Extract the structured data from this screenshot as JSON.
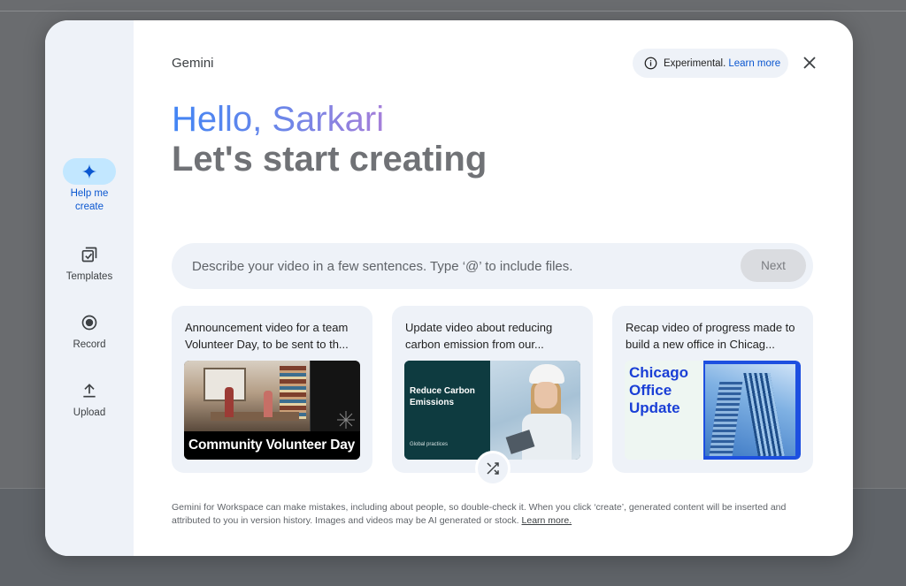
{
  "rail": {
    "items": [
      {
        "label": "Help me create",
        "icon": "sparkle-icon",
        "active": true
      },
      {
        "label": "Templates",
        "icon": "templates-icon",
        "active": false
      },
      {
        "label": "Record",
        "icon": "record-icon",
        "active": false
      },
      {
        "label": "Upload",
        "icon": "upload-icon",
        "active": false
      }
    ]
  },
  "header": {
    "brand": "Gemini",
    "experimental_label": "Experimental.",
    "learn_more": "Learn more",
    "close_icon": "close-icon",
    "info_icon": "info-icon"
  },
  "greeting": {
    "hello": "Hello, Sarkari",
    "subtitle": "Let's start creating"
  },
  "prompt": {
    "placeholder": "Describe your video in a few sentences. Type ‘@’ to include files.",
    "value": "",
    "next_label": "Next"
  },
  "cards": [
    {
      "text": "Announcement video for a team Volunteer Day, to be sent to th...",
      "thumb_caption": "Community Volunteer Day"
    },
    {
      "text": "Update video about reducing carbon emission from our...",
      "thumb_headline": "Reduce Carbon Emissions",
      "thumb_small": "Global practices"
    },
    {
      "text": "Recap video of progress made to build a new office in Chicag...",
      "thumb_title": "Chicago Office Update"
    }
  ],
  "shuffle_icon": "shuffle-icon",
  "disclaimer": {
    "text": "Gemini for Workspace can make mistakes, including about people, so double-check it. When you click ‘create’, generated content will be inserted and attributed to you in version history. Images and videos may be AI generated or stock.",
    "learn_more": "Learn more."
  },
  "colors": {
    "accent": "#0b57d0",
    "rail_active": "#c2e7ff",
    "surface": "#eef2f8",
    "chicago_blue": "#1a3fd6"
  }
}
